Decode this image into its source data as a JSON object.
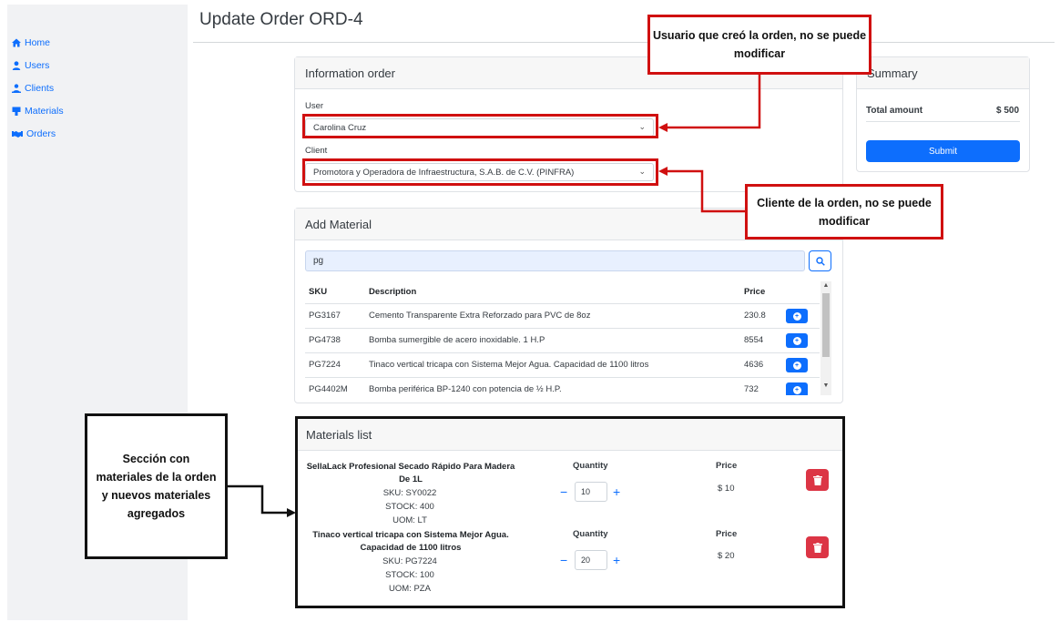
{
  "nav": [
    {
      "label": "Home",
      "icon": "home-icon"
    },
    {
      "label": "Users",
      "icon": "user-icon"
    },
    {
      "label": "Clients",
      "icon": "users-icon"
    },
    {
      "label": "Materials",
      "icon": "box-icon"
    },
    {
      "label": "Orders",
      "icon": "handshake-icon"
    }
  ],
  "page_title": "Update Order ORD-4",
  "info_order": {
    "header": "Information order",
    "user_label": "User",
    "user_value": "Carolina Cruz",
    "client_label": "Client",
    "client_value": "Promotora y Operadora de Infraestructura, S.A.B. de C.V. (PINFRA)"
  },
  "add_material": {
    "header": "Add Material",
    "search_value": "pg",
    "columns": {
      "sku": "SKU",
      "description": "Description",
      "price": "Price"
    },
    "rows": [
      {
        "sku": "PG3167",
        "description": "Cemento Transparente Extra Reforzado para PVC de 8oz",
        "price": "230.8"
      },
      {
        "sku": "PG4738",
        "description": "Bomba sumergible de acero inoxidable. 1 H.P",
        "price": "8554"
      },
      {
        "sku": "PG7224",
        "description": "Tinaco vertical tricapa con Sistema Mejor Agua. Capacidad de 1100 litros",
        "price": "4636"
      },
      {
        "sku": "PG4402M",
        "description": "Bomba periférica BP-1240 con potencia de ½ H.P.",
        "price": "732"
      }
    ]
  },
  "summary": {
    "header": "Summary",
    "total_label": "Total amount",
    "total_value": "$ 500",
    "submit_label": "Submit"
  },
  "materials_list": {
    "header": "Materials list",
    "quantity_label": "Quantity",
    "price_label": "Price",
    "items": [
      {
        "name_line1": "SellaLack Profesional Secado Rápido Para Madera",
        "name_line2": "De 1L",
        "sku": "SKU: SY0022",
        "stock": "STOCK: 400",
        "uom": "UOM: LT",
        "quantity": "10",
        "price": "$ 10"
      },
      {
        "name_line1": "Tinaco vertical tricapa con Sistema Mejor Agua.",
        "name_line2": "Capacidad de 1100 litros",
        "sku": "SKU: PG7224",
        "stock": "STOCK: 100",
        "uom": "UOM: PZA",
        "quantity": "20",
        "price": "$ 20"
      }
    ]
  },
  "annotations": {
    "user_note": "Usuario que creó la orden, no se puede modificar",
    "client_note": "Cliente de la orden, no se puede modificar",
    "materials_note": "Sección con materiales de la orden y nuevos materiales agregados"
  },
  "colors": {
    "primary": "#0d6efd",
    "danger": "#dc3545",
    "annotation_red": "#d01010"
  }
}
